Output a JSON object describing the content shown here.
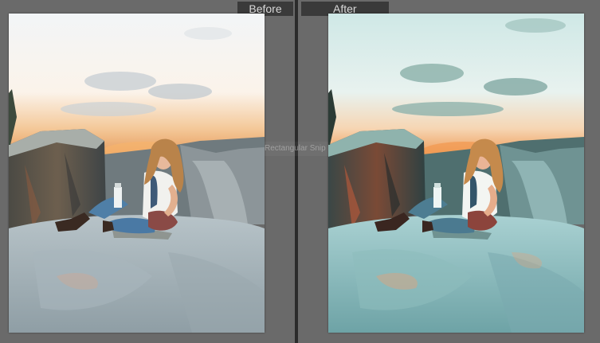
{
  "compare": {
    "before_label": "Before",
    "after_label": "After"
  },
  "overlay": {
    "ghost_text": "Rectangular Snip"
  },
  "colors": {
    "background": "#5f5f5f",
    "label_bg": "#3a3a3a",
    "label_text": "#d8d8d8",
    "divider": "#2b2b2b"
  }
}
